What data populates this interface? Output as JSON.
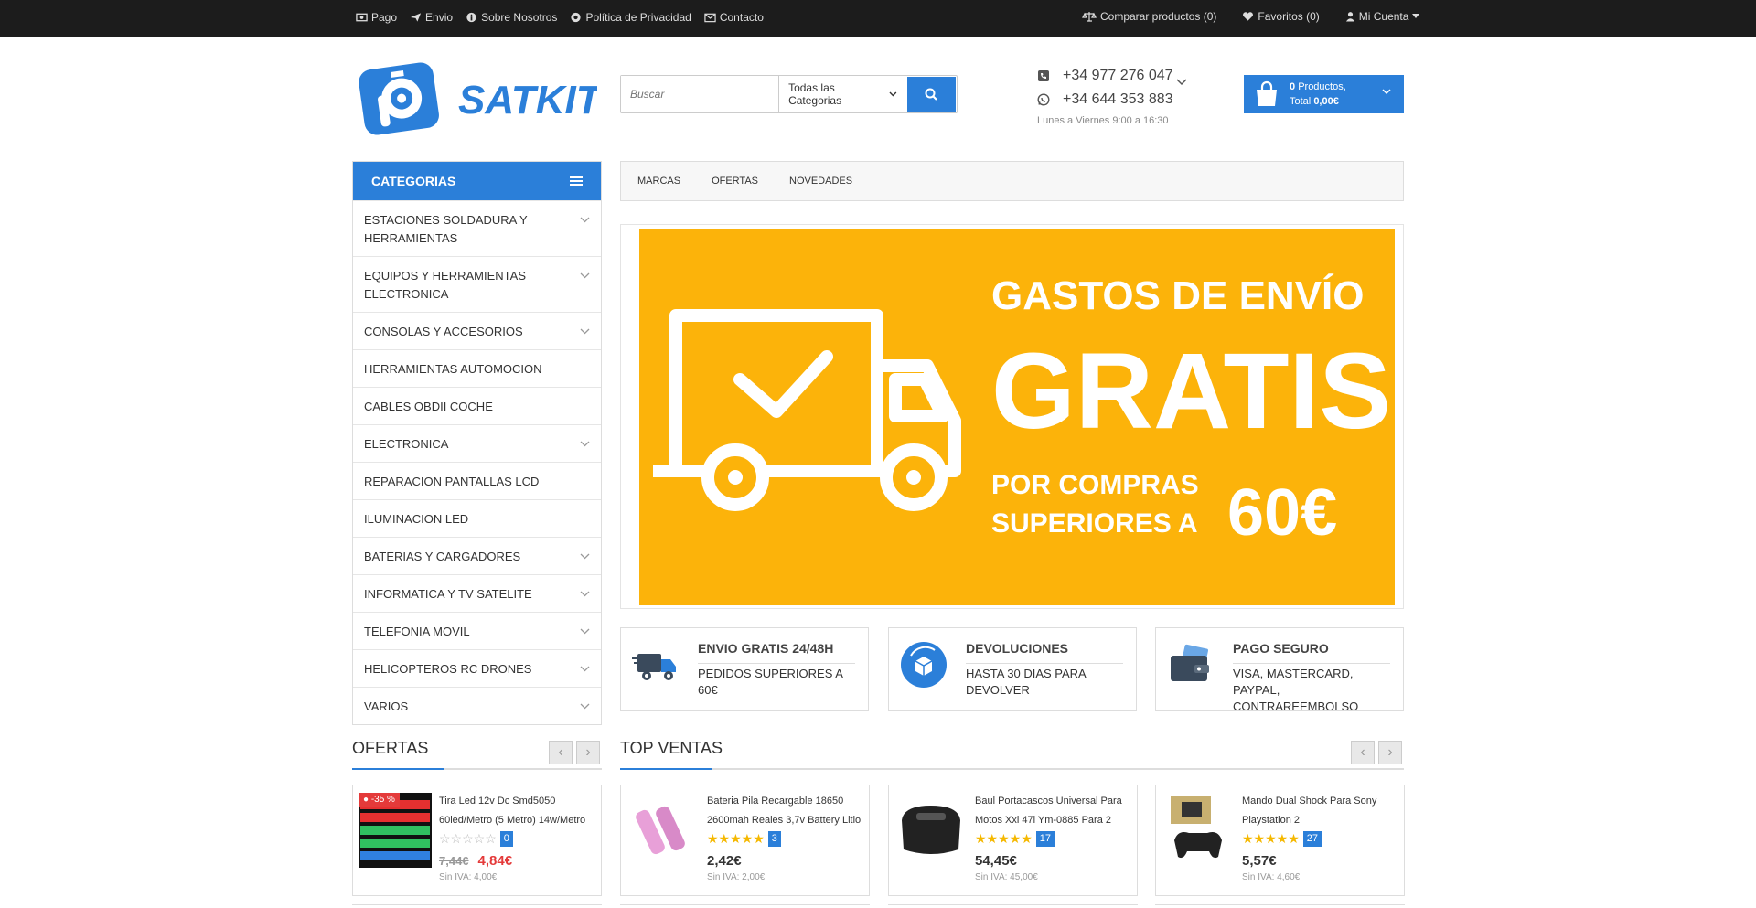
{
  "topbar": {
    "left": [
      {
        "label": "Pago",
        "icon": "money-icon"
      },
      {
        "label": "Envio",
        "icon": "plane-icon"
      },
      {
        "label": "Sobre Nosotros",
        "icon": "info-icon"
      },
      {
        "label": "Política de Privacidad",
        "icon": "lifebuoy-icon"
      },
      {
        "label": "Contacto",
        "icon": "envelope-icon"
      }
    ],
    "compare": "Comparar productos (0)",
    "favorites": "Favoritos (0)",
    "account": "Mi Cuenta"
  },
  "logo": {
    "text": "SATKIT"
  },
  "search": {
    "placeholder": "Buscar",
    "category": "Todas las Categorias"
  },
  "contact": {
    "phone1": "+34 977 276 047",
    "phone2": "+34 644 353 883",
    "hours": "Lunes a Viernes 9:00 a 16:30"
  },
  "cart": {
    "count": "0",
    "products_label": "Productos,",
    "total_label": "Total",
    "total": "0,00€"
  },
  "categories": {
    "title": "CATEGORIAS",
    "items": [
      {
        "label": "ESTACIONES SOLDADURA Y HERRAMIENTAS",
        "expand": true
      },
      {
        "label": "EQUIPOS Y HERRAMIENTAS ELECTRONICA",
        "expand": true
      },
      {
        "label": "CONSOLAS Y ACCESORIOS",
        "expand": true
      },
      {
        "label": "HERRAMIENTAS AUTOMOCION",
        "expand": false
      },
      {
        "label": "CABLES OBDII COCHE",
        "expand": false
      },
      {
        "label": "ELECTRONICA",
        "expand": true
      },
      {
        "label": "REPARACION PANTALLAS LCD",
        "expand": false
      },
      {
        "label": "ILUMINACION LED",
        "expand": false
      },
      {
        "label": "BATERIAS Y CARGADORES",
        "expand": true
      },
      {
        "label": "INFORMATICA Y TV SATELITE",
        "expand": true
      },
      {
        "label": "TELEFONIA MOVIL",
        "expand": true
      },
      {
        "label": "HELICOPTEROS RC DRONES",
        "expand": true
      },
      {
        "label": "VARIOS",
        "expand": true
      }
    ]
  },
  "nav": [
    "MARCAS",
    "OFERTAS",
    "NOVEDADES"
  ],
  "banner": {
    "line1": "GASTOS DE ENVÍO",
    "line2": "GRATIS",
    "line3": "POR COMPRAS",
    "line4": "SUPERIORES  A",
    "amount": "60€"
  },
  "features": [
    {
      "title": "ENVIO GRATIS 24/48H",
      "sub": "PEDIDOS SUPERIORES A 60€",
      "icon": "truck-icon"
    },
    {
      "title": "DEVOLUCIONES",
      "sub": "HASTA 30 DIAS PARA DEVOLVER",
      "icon": "box-return-icon"
    },
    {
      "title": "PAGO SEGURO",
      "sub": "VISA, MASTERCARD, PAYPAL, CONTRAREEMBOLSO",
      "icon": "wallet-icon"
    }
  ],
  "sections": {
    "offers": "OFERTAS",
    "top": "TOP VENTAS"
  },
  "products": [
    {
      "name": "Tira Led 12v Dc Smd5050 60led/Metro (5 Metro) 14w/Metro",
      "rating": 0,
      "count": "0",
      "old": "7,44€",
      "price": "4,84€",
      "tax": "Sin IVA: 4,00€",
      "badge": "-35 %"
    },
    {
      "name": "Bateria Pila Recargable 18650 2600mah Reales 3,7v Battery Litio",
      "rating": 5,
      "count": "3",
      "price": "2,42€",
      "tax": "Sin IVA: 2,00€"
    },
    {
      "name": "Baul Portacascos Universal Para Motos Xxl 47l Ym-0885 Para 2",
      "rating": 5,
      "count": "17",
      "price": "54,45€",
      "tax": "Sin IVA: 45,00€"
    },
    {
      "name": "Mando Dual Shock Para Sony Playstation 2",
      "rating": 5,
      "count": "27",
      "price": "5,57€",
      "tax": "Sin IVA: 4,60€"
    }
  ],
  "colors": {
    "accent": "#2b7fd9",
    "banner": "#fcb30a",
    "sale": "#e43a3a",
    "star": "#f5b800"
  }
}
